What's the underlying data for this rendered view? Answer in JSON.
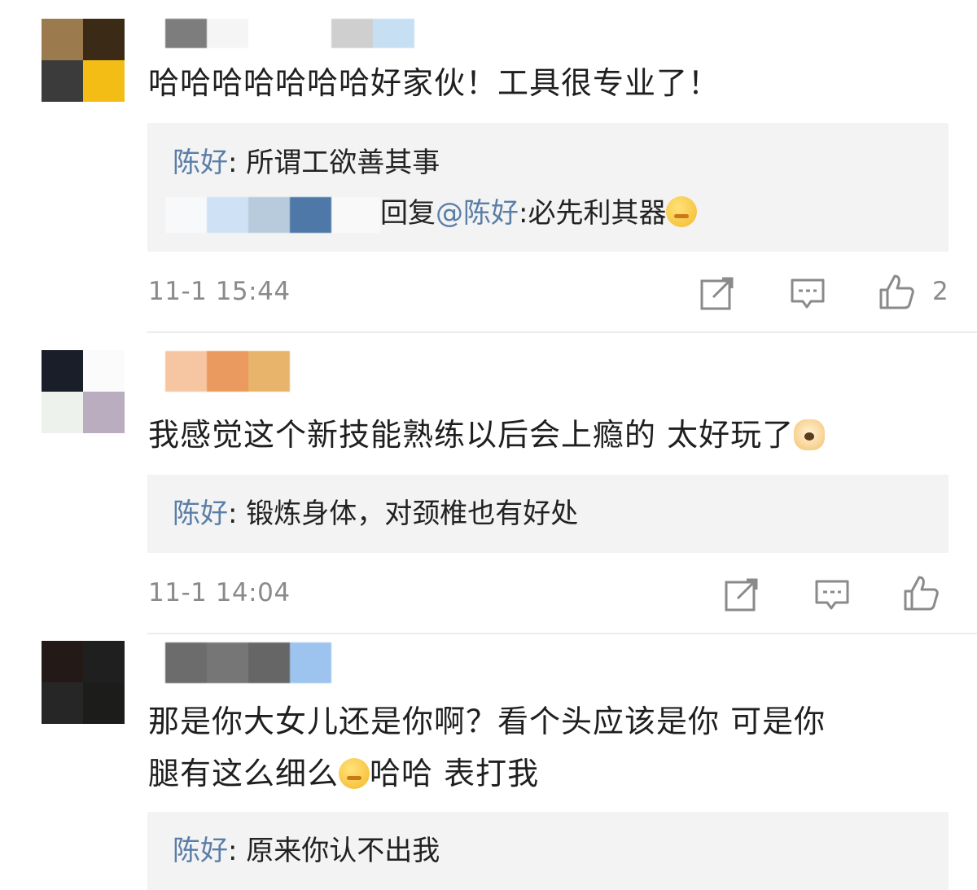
{
  "comments": [
    {
      "text": "哈哈哈哈哈哈哈好家伙！工具很专业了！",
      "replies": [
        {
          "name": "陈好",
          "sep": ": ",
          "text": "所谓工欲善其事"
        },
        {
          "prefix": "回复",
          "mention": "@陈好",
          "sep": ":",
          "text": "必先利其器"
        }
      ],
      "time": "11-1 15:44",
      "likes": "2"
    },
    {
      "text": "我感觉这个新技能熟练以后会上瘾的 太好玩了",
      "replies": [
        {
          "name": "陈好",
          "sep": ": ",
          "text": "锻炼身体，对颈椎也有好处"
        }
      ],
      "time": "11-1 14:04",
      "likes": ""
    },
    {
      "text_line1": "那是你大女儿还是你啊？看个头应该是你 可是你",
      "text_line2_a": "腿有这么细么",
      "text_line2_b": "哈哈 表打我",
      "replies": [
        {
          "name": "陈好",
          "sep": ": ",
          "text": "原来你认不出我"
        }
      ]
    }
  ],
  "icons": {
    "share": "share-icon",
    "comment": "comment-icon",
    "like": "thumbs-up-icon"
  },
  "colors": {
    "link_blue": "#5a7ea7",
    "meta_gray": "#8a8a8a",
    "reply_bg": "#f3f3f3"
  }
}
